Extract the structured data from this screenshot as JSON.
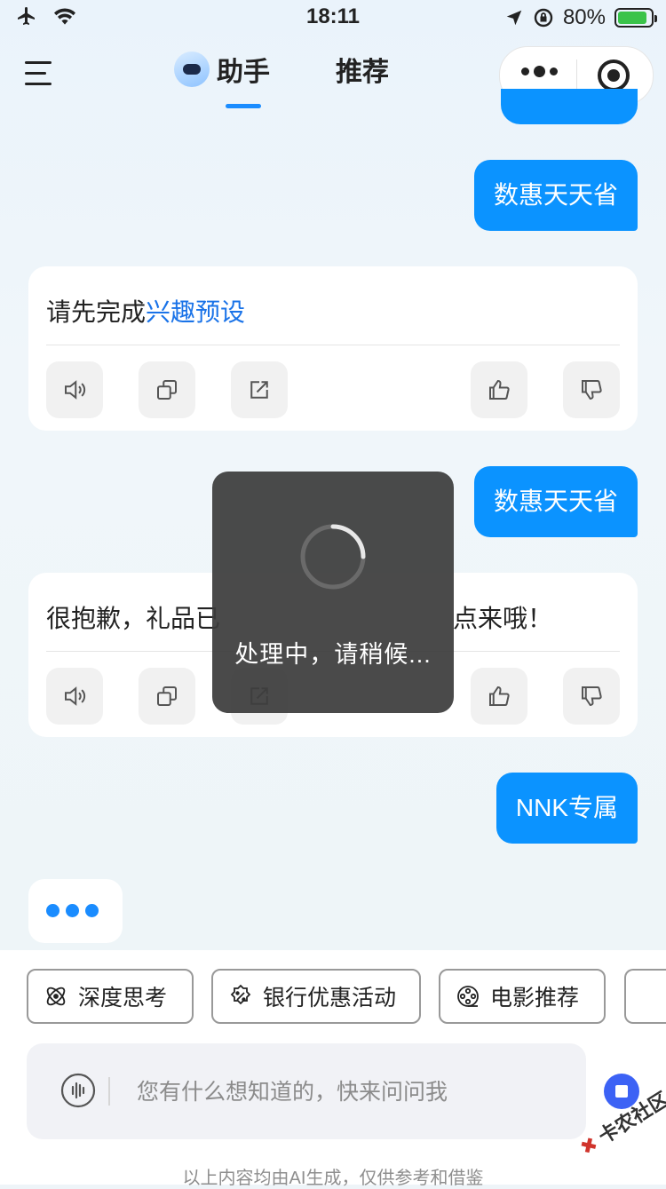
{
  "status_bar": {
    "time": "18:11",
    "battery": "80%"
  },
  "header": {
    "tabs": [
      {
        "label": "助手"
      },
      {
        "label": "推荐"
      }
    ]
  },
  "messages": [
    {
      "role": "user",
      "text": "数惠天天省"
    },
    {
      "role": "assistant",
      "text_prefix": "请先完成",
      "link_text": "兴趣预设"
    },
    {
      "role": "user",
      "text": "数惠天天省"
    },
    {
      "role": "assistant",
      "text_start": "很抱歉，礼品已",
      "text_end": "点来哦！"
    },
    {
      "role": "user",
      "text": "NNK专属"
    }
  ],
  "toast": {
    "text": "处理中，请稍候..."
  },
  "quick_actions": [
    {
      "label": "深度思考",
      "icon": "atom-icon"
    },
    {
      "label": "银行优惠活动",
      "icon": "discount-badge-icon"
    },
    {
      "label": "电影推荐",
      "icon": "film-reel-icon"
    }
  ],
  "input": {
    "placeholder": "您有什么想知道的，快来问问我"
  },
  "footer": {
    "disclaimer": "以上内容均由AI生成，仅供参考和借鉴",
    "watermark_brand": "卡农社区"
  },
  "colors": {
    "accent": "#0b93ff",
    "link": "#1a73e8",
    "stop_button": "#3c62f5"
  }
}
